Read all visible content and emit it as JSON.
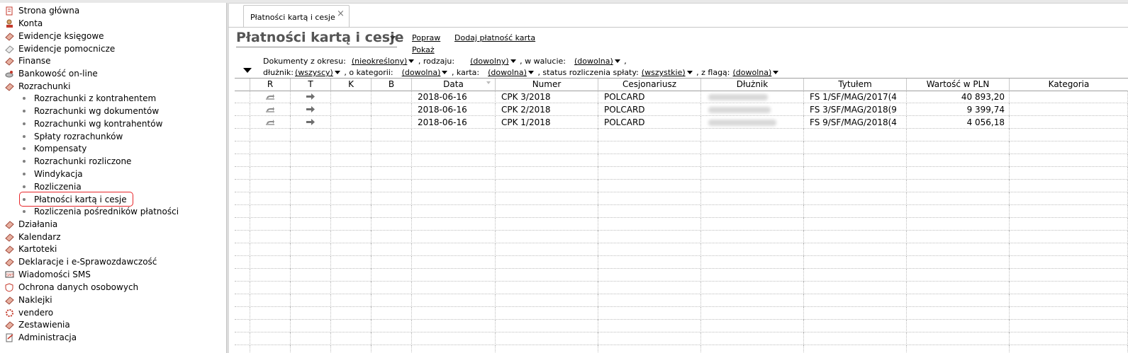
{
  "sidebar": {
    "items": [
      {
        "label": "Strona główna",
        "icon": "home-icon"
      },
      {
        "label": "Konta",
        "icon": "accounts-icon"
      },
      {
        "label": "Ewidencje księgowe",
        "icon": "ledger-icon"
      },
      {
        "label": "Ewidencje pomocnicze",
        "icon": "aux-ledger-icon"
      },
      {
        "label": "Finanse",
        "icon": "finance-icon"
      },
      {
        "label": "Bankowość on-line",
        "icon": "bank-icon"
      },
      {
        "label": "Rozrachunki",
        "icon": "settlements-icon"
      }
    ],
    "sub_items": [
      "Rozrachunki z kontrahentem",
      "Rozrachunki wg dokumentów",
      "Rozrachunki wg kontrahentów",
      "Spłaty rozrachunków",
      "Kompensaty",
      "Rozrachunki rozliczone",
      "Windykacja",
      "Rozliczenia",
      "Płatności kartą i cesje",
      "Rozliczenia pośredników płatności"
    ],
    "active_sub_index": 8,
    "items_after": [
      {
        "label": "Działania",
        "icon": "actions-icon"
      },
      {
        "label": "Kalendarz",
        "icon": "calendar-icon"
      },
      {
        "label": "Kartoteki",
        "icon": "records-icon"
      },
      {
        "label": "Deklaracje i e-Sprawozdawczość",
        "icon": "declarations-icon"
      },
      {
        "label": "Wiadomości SMS",
        "icon": "sms-icon"
      },
      {
        "label": "Ochrona danych osobowych",
        "icon": "data-protection-icon"
      },
      {
        "label": "Naklejki",
        "icon": "stickers-icon"
      },
      {
        "label": "vendero",
        "icon": "vendero-icon"
      },
      {
        "label": "Zestawienia",
        "icon": "reports-icon"
      },
      {
        "label": "Administracja",
        "icon": "admin-icon"
      }
    ]
  },
  "tab": {
    "label": "Płatności kartą i cesje",
    "close": "×"
  },
  "page": {
    "title": "Płatności kartą i cesje",
    "links": {
      "popraw": "Popraw",
      "pokaz": "Pokaż",
      "dodaj": "Dodaj płatność karta"
    }
  },
  "filters": {
    "row1": [
      {
        "label": "Dokumenty z okresu:",
        "value": "(nieokreślony)"
      },
      {
        "label": ", rodzaju:",
        "value": "(dowolny)"
      },
      {
        "label": ", w walucie:",
        "value": "(dowolna)"
      },
      {
        "label": ",",
        "value": ""
      }
    ],
    "row2": [
      {
        "label": "dłużnik:",
        "value": "(wszyscy)"
      },
      {
        "label": ", o kategorii:",
        "value": "(dowolna)"
      },
      {
        "label": ", karta:",
        "value": "(dowolna)"
      },
      {
        "label": ", status rozliczenia spłaty:",
        "value": "(wszystkie)"
      },
      {
        "label": ", z flagą:",
        "value": "(dowolna)"
      }
    ]
  },
  "table": {
    "columns": [
      "R",
      "T",
      "K",
      "B",
      "Data",
      "Numer",
      "Cesjonariusz",
      "Dłużnik",
      "Tytułem",
      "Wartość w PLN",
      "Kategoria"
    ],
    "rows": [
      {
        "data": "2018-06-16",
        "numer": "CPK 3/2018",
        "cesjonariusz": "POLCARD",
        "tytulem": "FS 1/SF/MAG/2017(4",
        "wartosc": "40 893,20"
      },
      {
        "data": "2018-06-16",
        "numer": "CPK 2/2018",
        "cesjonariusz": "POLCARD",
        "tytulem": "FS 3/SF/MAG/2018(9",
        "wartosc": "9 399,74"
      },
      {
        "data": "2018-06-16",
        "numer": "CPK 1/2018",
        "cesjonariusz": "POLCARD",
        "tytulem": "FS 9/SF/MAG/2018(4",
        "wartosc": "4 056,18"
      }
    ]
  },
  "colors": {
    "active_outline": "#e8262a",
    "title_text": "#555555"
  }
}
